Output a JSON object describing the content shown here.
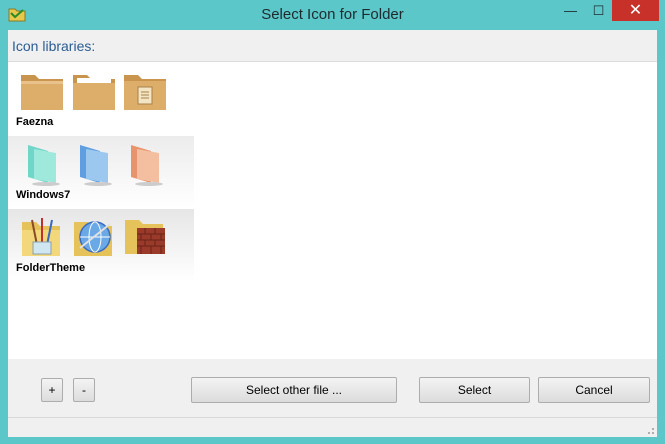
{
  "window": {
    "title": "Select Icon for Folder",
    "icons": {
      "app": "folder-app-icon",
      "minimize": "minimize-icon",
      "maximize": "maximize-icon",
      "close": "close-icon"
    }
  },
  "header": {
    "label": "Icon libraries:"
  },
  "libraries": [
    {
      "name": "Faezna",
      "icons": [
        "plain-folder-icon",
        "open-folder-icon",
        "document-folder-icon"
      ]
    },
    {
      "name": "Windows7",
      "icons": [
        "teal-folder-icon",
        "blue-folder-icon",
        "orange-folder-icon"
      ]
    },
    {
      "name": "FolderTheme",
      "icons": [
        "paint-brushes-folder-icon",
        "globe-folder-icon",
        "brick-wall-folder-icon"
      ]
    }
  ],
  "buttons": {
    "add": "+",
    "remove": "-",
    "select_other": "Select other file ...",
    "select": "Select",
    "cancel": "Cancel"
  },
  "colors": {
    "titlebar": "#5bc7c9",
    "close": "#c7312a",
    "header_text": "#2a5d93"
  }
}
